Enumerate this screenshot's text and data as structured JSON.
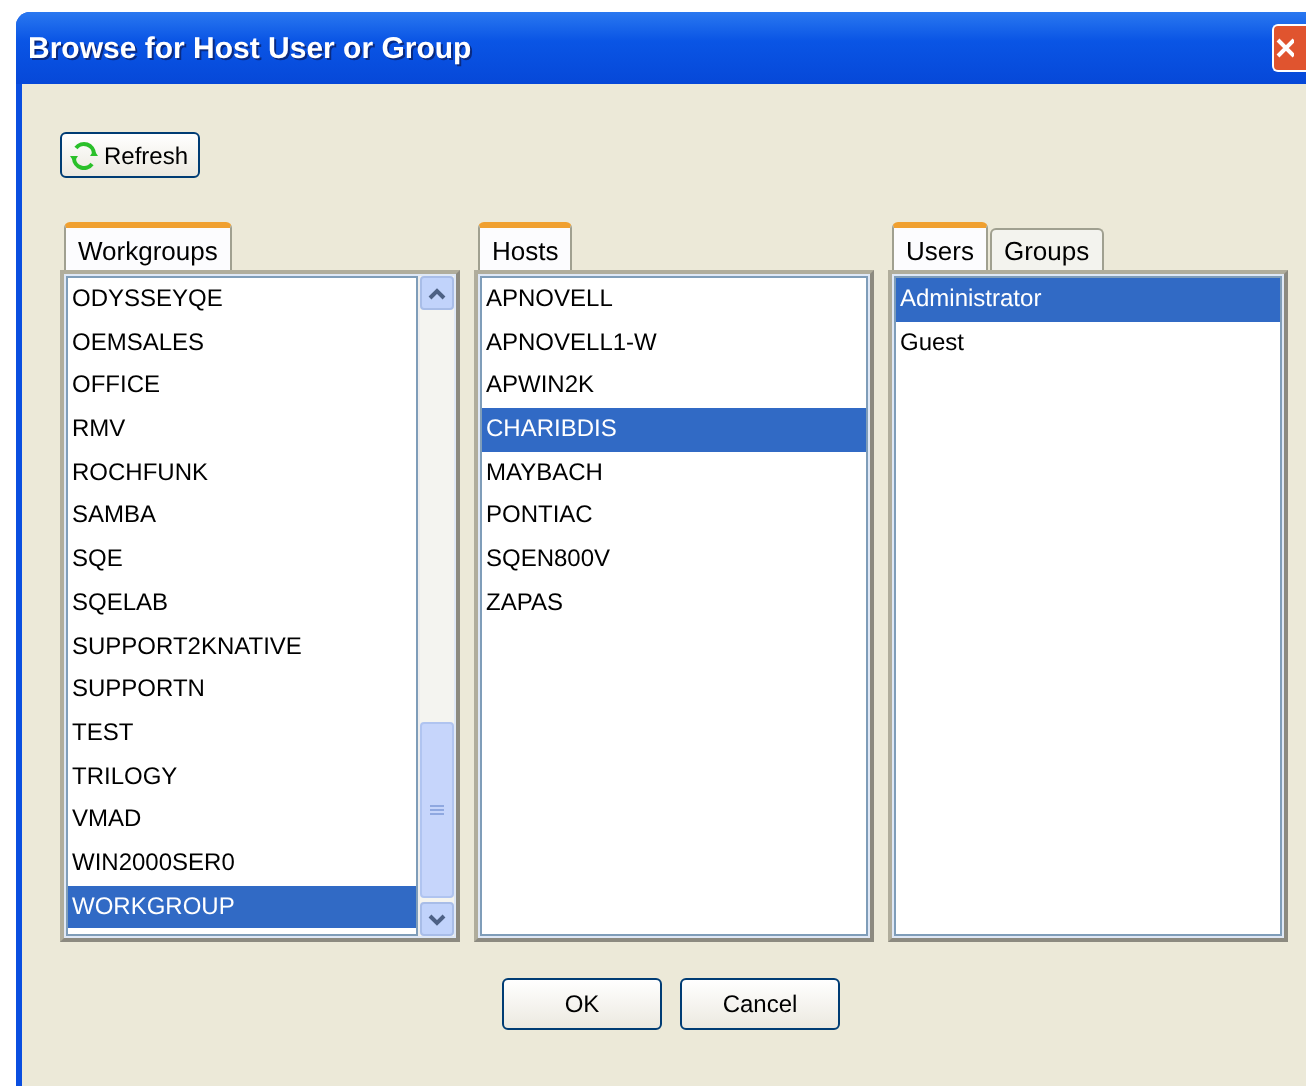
{
  "window": {
    "title": "Browse for Host User or Group"
  },
  "refresh_button": {
    "label": "Refresh"
  },
  "panels": [
    {
      "tabs": [
        {
          "label": "Workgroups",
          "selected": true
        }
      ],
      "scrollbar": true,
      "items": [
        {
          "label": "ODYSSEYQE",
          "selected": false
        },
        {
          "label": "OEMSALES",
          "selected": false
        },
        {
          "label": "OFFICE",
          "selected": false
        },
        {
          "label": "RMV",
          "selected": false
        },
        {
          "label": "ROCHFUNK",
          "selected": false
        },
        {
          "label": "SAMBA",
          "selected": false
        },
        {
          "label": "SQE",
          "selected": false
        },
        {
          "label": "SQELAB",
          "selected": false
        },
        {
          "label": "SUPPORT2KNATIVE",
          "selected": false
        },
        {
          "label": "SUPPORTN",
          "selected": false
        },
        {
          "label": "TEST",
          "selected": false
        },
        {
          "label": "TRILOGY",
          "selected": false
        },
        {
          "label": "VMAD",
          "selected": false
        },
        {
          "label": "WIN2000SER0",
          "selected": false
        },
        {
          "label": "WORKGROUP",
          "selected": true
        }
      ]
    },
    {
      "tabs": [
        {
          "label": "Hosts",
          "selected": true
        }
      ],
      "scrollbar": false,
      "items": [
        {
          "label": "APNOVELL",
          "selected": false
        },
        {
          "label": "APNOVELL1-W",
          "selected": false
        },
        {
          "label": "APWIN2K",
          "selected": false
        },
        {
          "label": "CHARIBDIS",
          "selected": true
        },
        {
          "label": "MAYBACH",
          "selected": false
        },
        {
          "label": "PONTIAC",
          "selected": false
        },
        {
          "label": "SQEN800V",
          "selected": false
        },
        {
          "label": "ZAPAS",
          "selected": false
        }
      ]
    },
    {
      "tabs": [
        {
          "label": "Users",
          "selected": true
        },
        {
          "label": "Groups",
          "selected": false
        }
      ],
      "scrollbar": false,
      "items": [
        {
          "label": "Administrator",
          "selected": true
        },
        {
          "label": "Guest",
          "selected": false
        }
      ]
    }
  ],
  "buttons": [
    "OK",
    "Cancel"
  ]
}
